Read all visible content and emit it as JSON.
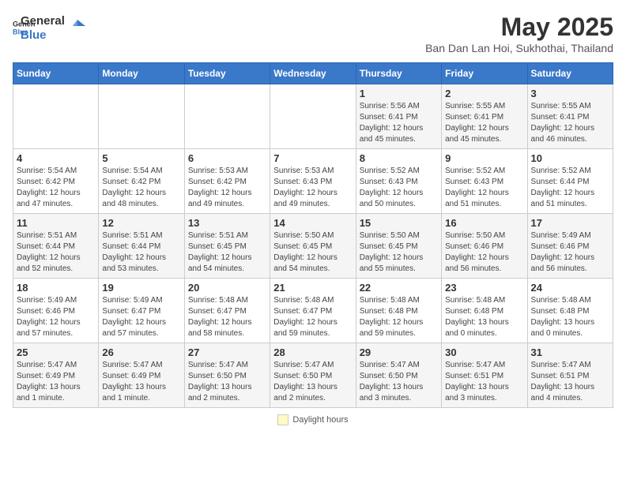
{
  "logo": {
    "text_general": "General",
    "text_blue": "Blue"
  },
  "title": "May 2025",
  "subtitle": "Ban Dan Lan Hoi, Sukhothai, Thailand",
  "columns": [
    "Sunday",
    "Monday",
    "Tuesday",
    "Wednesday",
    "Thursday",
    "Friday",
    "Saturday"
  ],
  "weeks": [
    [
      {
        "day": "",
        "sunrise": "",
        "sunset": "",
        "daylight": ""
      },
      {
        "day": "",
        "sunrise": "",
        "sunset": "",
        "daylight": ""
      },
      {
        "day": "",
        "sunrise": "",
        "sunset": "",
        "daylight": ""
      },
      {
        "day": "",
        "sunrise": "",
        "sunset": "",
        "daylight": ""
      },
      {
        "day": "1",
        "sunrise": "Sunrise: 5:56 AM",
        "sunset": "Sunset: 6:41 PM",
        "daylight": "Daylight: 12 hours and 45 minutes."
      },
      {
        "day": "2",
        "sunrise": "Sunrise: 5:55 AM",
        "sunset": "Sunset: 6:41 PM",
        "daylight": "Daylight: 12 hours and 45 minutes."
      },
      {
        "day": "3",
        "sunrise": "Sunrise: 5:55 AM",
        "sunset": "Sunset: 6:41 PM",
        "daylight": "Daylight: 12 hours and 46 minutes."
      }
    ],
    [
      {
        "day": "4",
        "sunrise": "Sunrise: 5:54 AM",
        "sunset": "Sunset: 6:42 PM",
        "daylight": "Daylight: 12 hours and 47 minutes."
      },
      {
        "day": "5",
        "sunrise": "Sunrise: 5:54 AM",
        "sunset": "Sunset: 6:42 PM",
        "daylight": "Daylight: 12 hours and 48 minutes."
      },
      {
        "day": "6",
        "sunrise": "Sunrise: 5:53 AM",
        "sunset": "Sunset: 6:42 PM",
        "daylight": "Daylight: 12 hours and 49 minutes."
      },
      {
        "day": "7",
        "sunrise": "Sunrise: 5:53 AM",
        "sunset": "Sunset: 6:43 PM",
        "daylight": "Daylight: 12 hours and 49 minutes."
      },
      {
        "day": "8",
        "sunrise": "Sunrise: 5:52 AM",
        "sunset": "Sunset: 6:43 PM",
        "daylight": "Daylight: 12 hours and 50 minutes."
      },
      {
        "day": "9",
        "sunrise": "Sunrise: 5:52 AM",
        "sunset": "Sunset: 6:43 PM",
        "daylight": "Daylight: 12 hours and 51 minutes."
      },
      {
        "day": "10",
        "sunrise": "Sunrise: 5:52 AM",
        "sunset": "Sunset: 6:44 PM",
        "daylight": "Daylight: 12 hours and 51 minutes."
      }
    ],
    [
      {
        "day": "11",
        "sunrise": "Sunrise: 5:51 AM",
        "sunset": "Sunset: 6:44 PM",
        "daylight": "Daylight: 12 hours and 52 minutes."
      },
      {
        "day": "12",
        "sunrise": "Sunrise: 5:51 AM",
        "sunset": "Sunset: 6:44 PM",
        "daylight": "Daylight: 12 hours and 53 minutes."
      },
      {
        "day": "13",
        "sunrise": "Sunrise: 5:51 AM",
        "sunset": "Sunset: 6:45 PM",
        "daylight": "Daylight: 12 hours and 54 minutes."
      },
      {
        "day": "14",
        "sunrise": "Sunrise: 5:50 AM",
        "sunset": "Sunset: 6:45 PM",
        "daylight": "Daylight: 12 hours and 54 minutes."
      },
      {
        "day": "15",
        "sunrise": "Sunrise: 5:50 AM",
        "sunset": "Sunset: 6:45 PM",
        "daylight": "Daylight: 12 hours and 55 minutes."
      },
      {
        "day": "16",
        "sunrise": "Sunrise: 5:50 AM",
        "sunset": "Sunset: 6:46 PM",
        "daylight": "Daylight: 12 hours and 56 minutes."
      },
      {
        "day": "17",
        "sunrise": "Sunrise: 5:49 AM",
        "sunset": "Sunset: 6:46 PM",
        "daylight": "Daylight: 12 hours and 56 minutes."
      }
    ],
    [
      {
        "day": "18",
        "sunrise": "Sunrise: 5:49 AM",
        "sunset": "Sunset: 6:46 PM",
        "daylight": "Daylight: 12 hours and 57 minutes."
      },
      {
        "day": "19",
        "sunrise": "Sunrise: 5:49 AM",
        "sunset": "Sunset: 6:47 PM",
        "daylight": "Daylight: 12 hours and 57 minutes."
      },
      {
        "day": "20",
        "sunrise": "Sunrise: 5:48 AM",
        "sunset": "Sunset: 6:47 PM",
        "daylight": "Daylight: 12 hours and 58 minutes."
      },
      {
        "day": "21",
        "sunrise": "Sunrise: 5:48 AM",
        "sunset": "Sunset: 6:47 PM",
        "daylight": "Daylight: 12 hours and 59 minutes."
      },
      {
        "day": "22",
        "sunrise": "Sunrise: 5:48 AM",
        "sunset": "Sunset: 6:48 PM",
        "daylight": "Daylight: 12 hours and 59 minutes."
      },
      {
        "day": "23",
        "sunrise": "Sunrise: 5:48 AM",
        "sunset": "Sunset: 6:48 PM",
        "daylight": "Daylight: 13 hours and 0 minutes."
      },
      {
        "day": "24",
        "sunrise": "Sunrise: 5:48 AM",
        "sunset": "Sunset: 6:48 PM",
        "daylight": "Daylight: 13 hours and 0 minutes."
      }
    ],
    [
      {
        "day": "25",
        "sunrise": "Sunrise: 5:47 AM",
        "sunset": "Sunset: 6:49 PM",
        "daylight": "Daylight: 13 hours and 1 minute."
      },
      {
        "day": "26",
        "sunrise": "Sunrise: 5:47 AM",
        "sunset": "Sunset: 6:49 PM",
        "daylight": "Daylight: 13 hours and 1 minute."
      },
      {
        "day": "27",
        "sunrise": "Sunrise: 5:47 AM",
        "sunset": "Sunset: 6:50 PM",
        "daylight": "Daylight: 13 hours and 2 minutes."
      },
      {
        "day": "28",
        "sunrise": "Sunrise: 5:47 AM",
        "sunset": "Sunset: 6:50 PM",
        "daylight": "Daylight: 13 hours and 2 minutes."
      },
      {
        "day": "29",
        "sunrise": "Sunrise: 5:47 AM",
        "sunset": "Sunset: 6:50 PM",
        "daylight": "Daylight: 13 hours and 3 minutes."
      },
      {
        "day": "30",
        "sunrise": "Sunrise: 5:47 AM",
        "sunset": "Sunset: 6:51 PM",
        "daylight": "Daylight: 13 hours and 3 minutes."
      },
      {
        "day": "31",
        "sunrise": "Sunrise: 5:47 AM",
        "sunset": "Sunset: 6:51 PM",
        "daylight": "Daylight: 13 hours and 4 minutes."
      }
    ]
  ],
  "footer": {
    "daylight_label": "Daylight hours",
    "daylight_color": "#fff9c4"
  }
}
